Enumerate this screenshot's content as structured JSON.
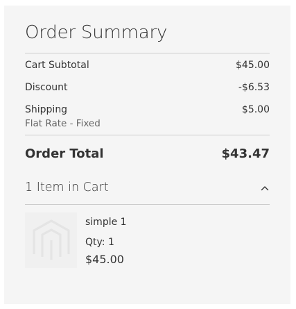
{
  "summary": {
    "title": "Order Summary",
    "rows": [
      {
        "label": "Cart Subtotal",
        "value": "$45.00"
      },
      {
        "label": "Discount",
        "value": "-$6.53"
      },
      {
        "label": "Shipping",
        "value": "$5.00",
        "sublabel": "Flat Rate - Fixed"
      }
    ],
    "total": {
      "label": "Order Total",
      "value": "$43.47"
    }
  },
  "cart": {
    "header": "1 Item in Cart",
    "toggle_icon": "chevron-up-icon",
    "items": [
      {
        "name": "simple 1",
        "qty": "Qty: 1",
        "price": "$45.00",
        "image_icon": "magento-logo-placeholder-icon"
      }
    ]
  },
  "colors": {
    "panel_bg": "#f5f5f5",
    "text": "#333333",
    "muted_text": "#666666",
    "divider": "#cccccc"
  }
}
